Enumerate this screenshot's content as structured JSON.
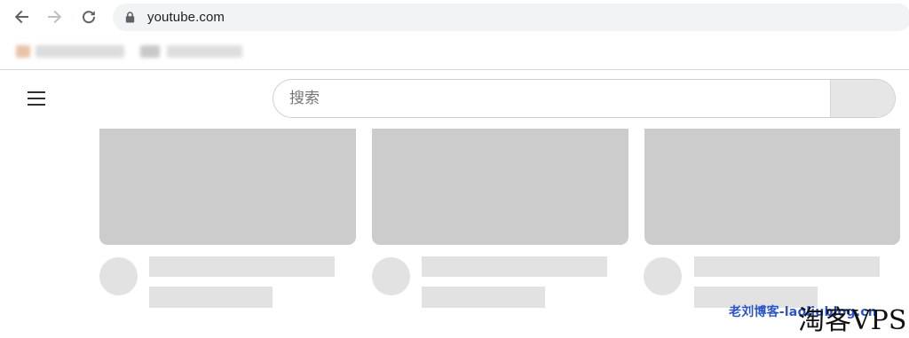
{
  "browser": {
    "url": "youtube.com",
    "icons": {
      "back": "arrow-left",
      "forward": "arrow-right",
      "reload": "refresh",
      "secure": "lock"
    },
    "bookmark_colors": [
      "#e8c3a8",
      "#c8c8c8",
      "#d4d4d4",
      "#cfcfcf",
      "#d9d9d9",
      "#e0e0e0"
    ]
  },
  "youtube": {
    "search": {
      "placeholder": "搜索",
      "value": ""
    },
    "menu_icon": "hamburger",
    "search_button_icon": "none",
    "video_placeholders": 3,
    "skeleton_colors": {
      "thumbnail": "#cccccc",
      "line": "#e2e2e2"
    }
  },
  "watermark": {
    "blog_text": "老刘博客-laoliublog.cn",
    "brand_text": "淘客VPS",
    "blog_color": "#2b54c8"
  }
}
